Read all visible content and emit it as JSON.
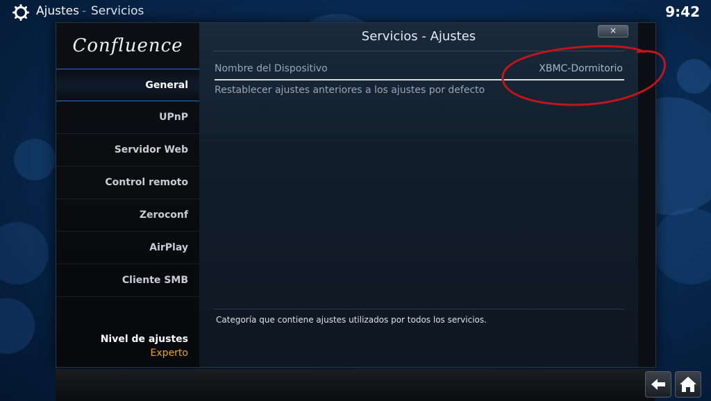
{
  "header": {
    "section": "Ajustes",
    "separator": "-",
    "subsection": "Servicios",
    "clock": "9:42"
  },
  "sidebar": {
    "logo": "Confluence",
    "items": [
      {
        "label": "General",
        "active": true
      },
      {
        "label": "UPnP"
      },
      {
        "label": "Servidor Web"
      },
      {
        "label": "Control remoto"
      },
      {
        "label": "Zeroconf"
      },
      {
        "label": "AirPlay"
      },
      {
        "label": "Cliente SMB"
      }
    ],
    "level_label": "Nivel de ajustes",
    "level_value": "Experto"
  },
  "dialog": {
    "title": "Servicios - Ajustes",
    "close_label": "×",
    "settings": [
      {
        "label": "Nombre del Dispositivo",
        "value": "XBMC-Dormitorio"
      },
      {
        "label": "Restablecer ajustes anteriores a los ajustes por defecto",
        "value": ""
      }
    ],
    "description": "Categoría que contiene ajustes utilizados por todos los servicios."
  },
  "icons": {
    "top_left": "gear-icon",
    "back": "back-arrow-icon",
    "home": "home-icon"
  },
  "colors": {
    "accent": "#2a75c5",
    "level_value": "#e8a32a",
    "annotation": "#c2151a"
  }
}
